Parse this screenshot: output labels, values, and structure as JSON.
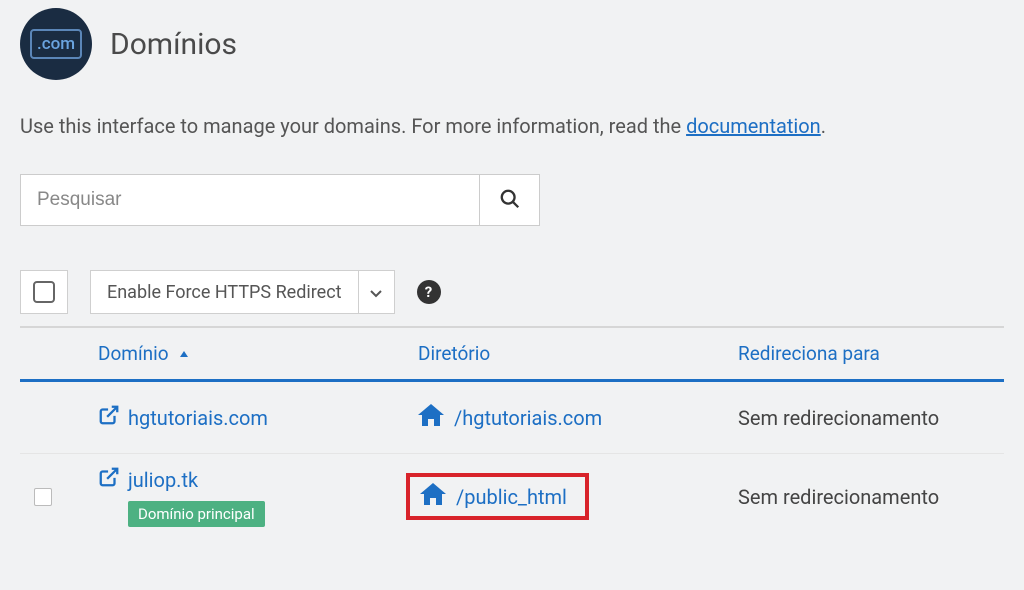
{
  "header": {
    "icon_text": ".com",
    "title": "Domínios"
  },
  "intro": {
    "text_before": "Use this interface to manage your domains. For more information, read the ",
    "link_text": "documentation",
    "text_after": "."
  },
  "search": {
    "placeholder": "Pesquisar"
  },
  "toolbar": {
    "force_label": "Enable Force HTTPS Redirect",
    "help_label": "?"
  },
  "table": {
    "columns": {
      "domain": "Domínio",
      "directory": "Diretório",
      "redirect": "Redireciona para"
    },
    "rows": [
      {
        "domain": "hgtutoriais.com",
        "directory": "/hgtutoriais.com",
        "redirect": "Sem redirecionamento",
        "primary": false,
        "highlighted": false,
        "checkbox_visible": false
      },
      {
        "domain": "juliop.tk",
        "directory": "/public_html",
        "redirect": "Sem redirecionamento",
        "primary": true,
        "highlighted": true,
        "checkbox_visible": true
      }
    ],
    "primary_badge": "Domínio principal"
  }
}
